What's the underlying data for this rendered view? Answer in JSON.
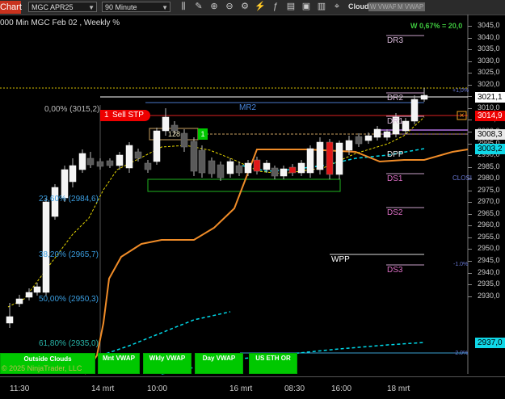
{
  "toolbar": {
    "chart_label": "Chart",
    "instrument": "MGC APR25",
    "interval": "90 Minute",
    "cloud_label": "Cloud",
    "w_vwap_label": "W VWAP",
    "m_vwap_label": "M VWAP"
  },
  "chart": {
    "title": "000 Min MGC Feb 02 , Weekly %",
    "weekly_pct": "W 0,67% = 20,0",
    "copyright": "© 2025 NinjaTrader, LLC",
    "y_axis_ticks": [
      "3045,0",
      "3040,0",
      "3035,0",
      "3030,0",
      "3025,0",
      "3020,0",
      "3015,0",
      "3010,0",
      "3005,0",
      "3000,0",
      "2995,0",
      "2990,0",
      "2985,0",
      "2980,0",
      "2975,0",
      "2970,0",
      "2965,0",
      "2960,0",
      "2955,0",
      "2950,0",
      "2945,0",
      "2940,0",
      "2935,0",
      "2930,0"
    ],
    "x_axis_ticks": [
      "11:30",
      "14 mrt",
      "10:00",
      "16 mrt",
      "08:30",
      "16:00",
      "18 mrt"
    ],
    "price_tags": {
      "last": "3021,1",
      "sell": "3014,9",
      "level1": "3008,3",
      "level2": "3003,2",
      "level3": "2937,0"
    },
    "fib_labels": {
      "f0": "0,00% (3015,2)",
      "f236": "23,60% (2984,6)",
      "f382": "38,20% (2965,7)",
      "f50": "50,00% (2950,3)",
      "f618": "61,80% (2935,0)"
    },
    "pivot_labels": {
      "dr3": "DR3",
      "dr2": "DR2",
      "dr1": "DR1",
      "dpp": "DPP",
      "ds1": "DS1",
      "ds2": "DS2",
      "ds3": "DS3",
      "mr2": "MR2",
      "wpp": "WPP"
    },
    "pct_labels": {
      "p1": "+1,0%",
      "m1": "-1.0%",
      "m2": "-2.0%"
    },
    "close_label": "CLOSI",
    "sell_order": {
      "qty": "1",
      "label": "Sell STP"
    },
    "order_box": {
      "qty": "128",
      "btn": "1"
    },
    "bottom_buttons": {
      "outside_clouds": "Outside Clouds",
      "mnt_vwap": "Mnt VWAP",
      "wkly_vwap": "Wkly VWAP",
      "day_vwap": "Day VWAP",
      "us_eth_or": "US ETH OR"
    }
  }
}
